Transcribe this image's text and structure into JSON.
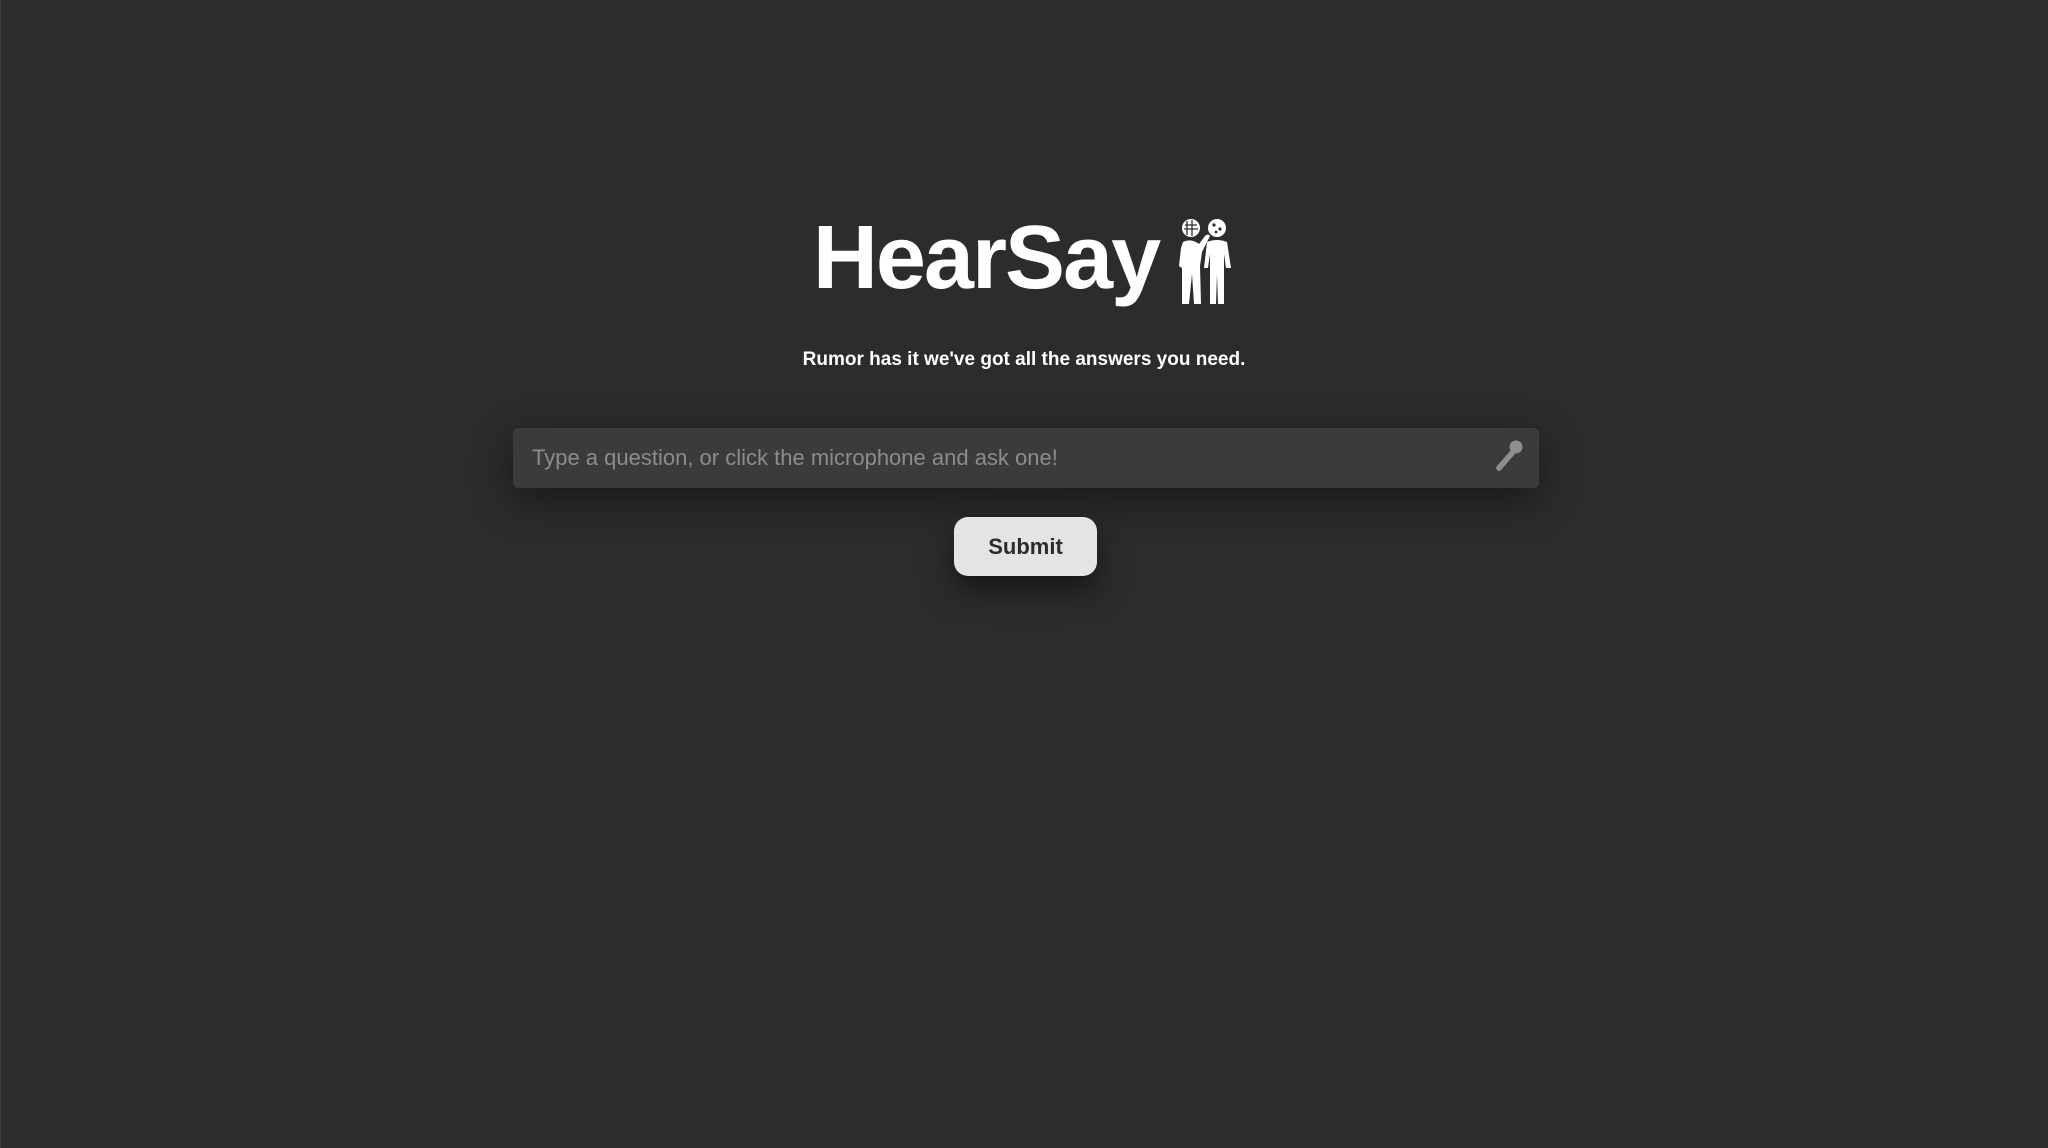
{
  "app": {
    "title": "HearSay",
    "tagline": "Rumor has it we've got all the answers you need."
  },
  "logo": {
    "icon": "two-people-whispering-icon"
  },
  "search": {
    "placeholder": "Type a question, or click the microphone and ask one!",
    "value": "",
    "mic_icon": "microphone-icon"
  },
  "actions": {
    "submit_label": "Submit"
  },
  "colors": {
    "background": "#2c2c2c",
    "input_background": "#3b3b3b",
    "button_background": "#e4e4e4",
    "text_primary": "#ffffff",
    "placeholder": "#8c8c8c"
  }
}
